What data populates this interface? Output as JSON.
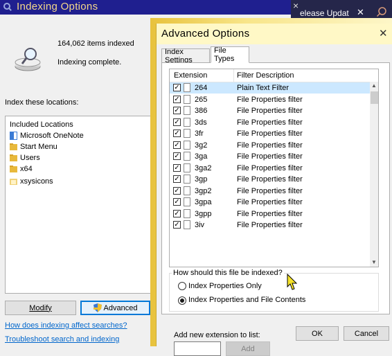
{
  "indexing_window": {
    "title": "Indexing Options",
    "items_indexed": "164,062 items indexed",
    "status": "Indexing complete.",
    "locations_label": "Index these locations:",
    "locations_header": "Included Locations",
    "locations": [
      {
        "label": "Microsoft OneNote",
        "icon": "onenote-icon"
      },
      {
        "label": "Start Menu",
        "icon": "folder-icon"
      },
      {
        "label": "Users",
        "icon": "folder-icon"
      },
      {
        "label": "x64",
        "icon": "folder-icon"
      },
      {
        "label": "xsysicons",
        "icon": "folder-icon"
      }
    ],
    "modify_label": "Modify",
    "advanced_label": "Advanced",
    "link_affect": "How does indexing affect searches?",
    "link_troubleshoot": "Troubleshoot search and indexing"
  },
  "background_app": {
    "text": "elease Updat",
    "close_glyph": "×"
  },
  "advanced_dialog": {
    "title": "Advanced Options",
    "tabs": [
      {
        "label": "Index Settings",
        "active": false
      },
      {
        "label": "File Types",
        "active": true
      }
    ],
    "columns": {
      "extension": "Extension",
      "filter": "Filter Description"
    },
    "rows": [
      {
        "ext": "264",
        "filter": "Plain Text Filter",
        "checked": true,
        "selected": true
      },
      {
        "ext": "265",
        "filter": "File Properties filter",
        "checked": true
      },
      {
        "ext": "386",
        "filter": "File Properties filter",
        "checked": true
      },
      {
        "ext": "3ds",
        "filter": "File Properties filter",
        "checked": true
      },
      {
        "ext": "3fr",
        "filter": "File Properties filter",
        "checked": true
      },
      {
        "ext": "3g2",
        "filter": "File Properties filter",
        "checked": true
      },
      {
        "ext": "3ga",
        "filter": "File Properties filter",
        "checked": true
      },
      {
        "ext": "3ga2",
        "filter": "File Properties filter",
        "checked": true
      },
      {
        "ext": "3gp",
        "filter": "File Properties filter",
        "checked": true
      },
      {
        "ext": "3gp2",
        "filter": "File Properties filter",
        "checked": true
      },
      {
        "ext": "3gpa",
        "filter": "File Properties filter",
        "checked": true
      },
      {
        "ext": "3gpp",
        "filter": "File Properties filter",
        "checked": true
      },
      {
        "ext": "3iv",
        "filter": "File Properties filter",
        "checked": true
      }
    ],
    "howto_label": "How should this file be indexed?",
    "radio_properties_only": "Index Properties Only",
    "radio_properties_and_contents": "Index Properties and File Contents",
    "selected_radio": "properties_and_contents",
    "add_ext_label": "Add new extension to list:",
    "add_ext_value": "",
    "add_label": "Add",
    "ok_label": "OK",
    "cancel_label": "Cancel"
  },
  "colors": {
    "indexing_titlebar": "#1f1f8f",
    "dialog_glow": "#e8c23c",
    "selected_row": "#cce8ff",
    "link": "#0066cc"
  }
}
